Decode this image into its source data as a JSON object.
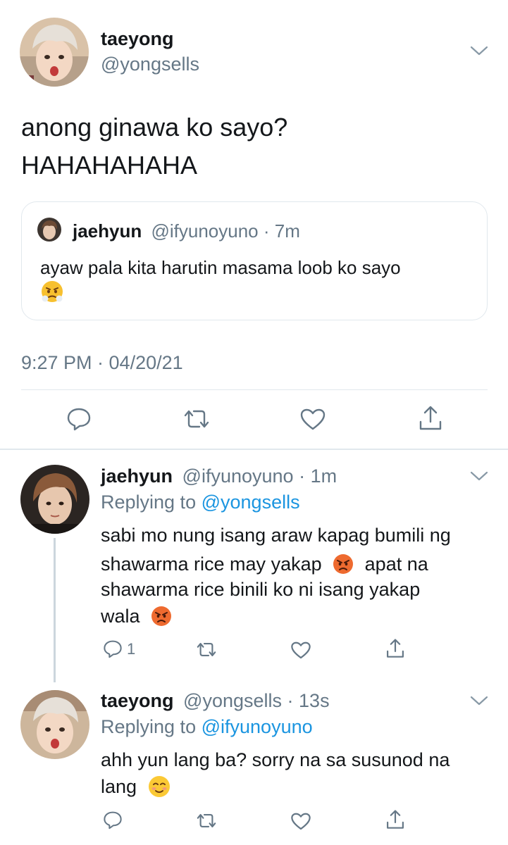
{
  "main_tweet": {
    "author_name": "taeyong",
    "author_handle": "@yongsells",
    "text_line1": "anong ginawa ko sayo?",
    "text_line2": "HAHAHAHAHA",
    "timestamp": "9:27 PM · 04/20/21",
    "avatar_icon": "avatar-taeyong",
    "quoted": {
      "author_name": "jaehyun",
      "author_handle": "@ifyunoyuno",
      "time": "· 7m",
      "text": "ayaw pala kita harutin masama loob ko sayo",
      "emoji_icon": "face-with-steam-from-nose"
    },
    "actions": [
      "reply-icon",
      "retweet-icon",
      "like-icon",
      "share-icon"
    ]
  },
  "replies": [
    {
      "author_name": "jaehyun",
      "author_handle": "@ifyunoyuno",
      "time": "· 1m",
      "replying_prefix": "Replying to",
      "replying_to": "@yongsells",
      "line1": "sabi mo nung isang araw kapag bumili ng",
      "line2a": "shawarma rice may yakap",
      "line2b": "apat na",
      "line3": "shawarma rice binili ko ni isang yakap",
      "line4": "wala",
      "emoji_icon": "angry-face",
      "reply_count": "1"
    },
    {
      "author_name": "taeyong",
      "author_handle": "@yongsells",
      "time": "· 13s",
      "replying_prefix": "Replying to",
      "replying_to": "@ifyunoyuno",
      "line1": "ahh yun lang ba? sorry na sa susunod na",
      "line2": "lang",
      "emoji_icon": "smiling-face"
    }
  ],
  "colors": {
    "text": "#14171a",
    "muted": "#657786",
    "link": "#1b95e0",
    "divider": "#e1e8ed",
    "thread_line": "#ccd6dd"
  }
}
